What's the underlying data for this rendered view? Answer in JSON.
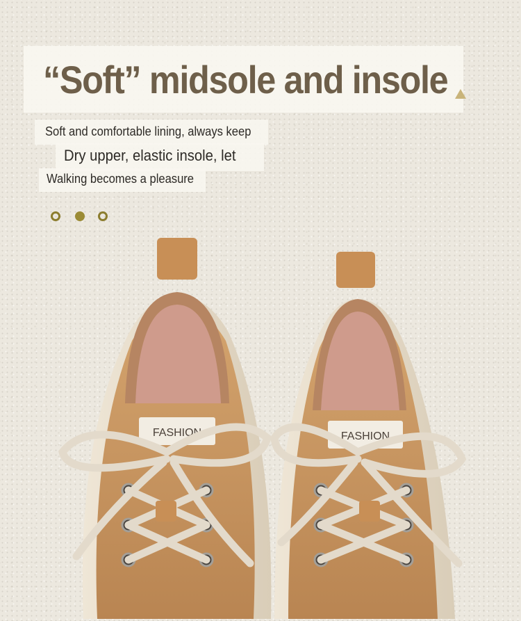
{
  "headline": "“Soft” midsole and insole",
  "description": {
    "line1": "Soft and comfortable lining, always keep",
    "line2": "Dry upper, elastic insole, let",
    "line3": "Walking becomes a pleasure"
  },
  "carousel": {
    "total": 3,
    "active_index": 1
  },
  "product_photo": {
    "left_label": "FASHION",
    "right_label": "FASHION",
    "subject": "pair of tan suede lace-up sneakers, top view"
  },
  "colors": {
    "background": "#ece8df",
    "title": "#6e5f4a",
    "accent": "#9b8b35",
    "suede": "#c99a63"
  }
}
